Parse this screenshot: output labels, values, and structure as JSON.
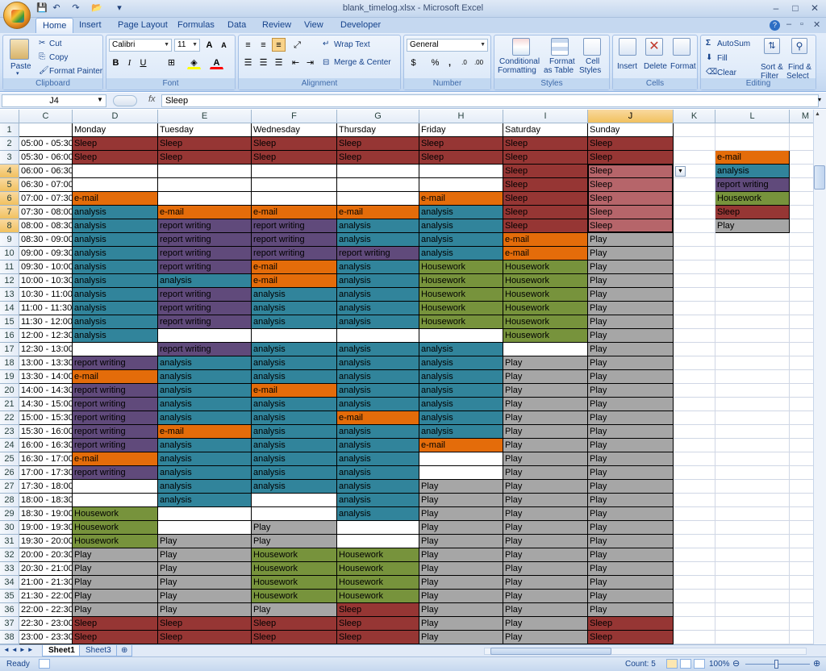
{
  "window": {
    "title": "blank_timelog.xlsx - Microsoft Excel"
  },
  "tabs": [
    "Home",
    "Insert",
    "Page Layout",
    "Formulas",
    "Data",
    "Review",
    "View",
    "Developer"
  ],
  "ribbon": {
    "clipboard": {
      "label": "Clipboard",
      "paste": "Paste",
      "cut": "Cut",
      "copy": "Copy",
      "format_painter": "Format Painter"
    },
    "font": {
      "label": "Font",
      "name": "Calibri",
      "size": "11",
      "bold": "B",
      "italic": "I",
      "underline": "U"
    },
    "alignment": {
      "label": "Alignment",
      "wrap": "Wrap Text",
      "merge": "Merge & Center"
    },
    "number": {
      "label": "Number",
      "format": "General",
      "currency": "$",
      "percent": "%",
      "comma": ","
    },
    "styles": {
      "label": "Styles",
      "conditional_l1": "Conditional",
      "conditional_l2": "Formatting",
      "table_l1": "Format",
      "table_l2": "as Table",
      "cell_l1": "Cell",
      "cell_l2": "Styles"
    },
    "cells": {
      "label": "Cells",
      "insert": "Insert",
      "delete": "Delete",
      "format": "Format"
    },
    "editing": {
      "label": "Editing",
      "autosum": "AutoSum",
      "fill": "Fill",
      "clear": "Clear",
      "sort_l1": "Sort &",
      "sort_l2": "Filter",
      "find_l1": "Find &",
      "find_l2": "Select"
    }
  },
  "formula_bar": {
    "name_box": "J4",
    "fx": "fx",
    "content": "Sleep"
  },
  "columns": [
    "C",
    "D",
    "E",
    "F",
    "G",
    "H",
    "I",
    "J",
    "K",
    "L",
    "M"
  ],
  "headers": [
    "Monday",
    "Tuesday",
    "Wednesday",
    "Thursday",
    "Friday",
    "Saturday",
    "Sunday"
  ],
  "times": [
    "05:00 - 05:30",
    "05:30 - 06:00",
    "06:00 - 06:30",
    "06:30 - 07:00",
    "07:00 - 07:30",
    "07:30 - 08:00",
    "08:00 - 08:30",
    "08:30 - 09:00",
    "09:00 - 09:30",
    "09:30 - 10:00",
    "10:00 - 10:30",
    "10:30 - 11:00",
    "11:00 - 11:30",
    "11:30 - 12:00",
    "12:00 - 12:30",
    "12:30 - 13:00",
    "13:00 - 13:30",
    "13:30 - 14:00",
    "14:00 - 14:30",
    "14:30 - 15:00",
    "15:00 - 15:30",
    "15:30 - 16:00",
    "16:00 - 16:30",
    "16:30 - 17:00",
    "17:00 - 17:30",
    "17:30 - 18:00",
    "18:00 - 18:30",
    "18:30 - 19:00",
    "19:00 - 19:30",
    "19:30 - 20:00",
    "20:00 - 20:30",
    "20:30 - 21:00",
    "21:00 - 21:30",
    "21:30 - 22:00",
    "22:00 - 22:30",
    "22:30 - 23:00",
    "23:00 - 23:30"
  ],
  "activity_codes": {
    "a": "analysis",
    "e": "e-mail",
    "r": "report writing",
    "h": "Housework",
    "s": "Sleep",
    "p": "Play",
    "w": ""
  },
  "colors": {
    "analysis": "#31849b",
    "e-mail": "#e46c0a",
    "report writing": "#604a7b",
    "Housework": "#77933c",
    "Sleep": "#963634",
    "Play": "#a6a6a6"
  },
  "grid": [
    "sssssss",
    "sssssss",
    "wwwwwss",
    "wwwwwss",
    "ewwwess",
    "aeeeass",
    "arraass",
    "arraaep",
    "arrraep",
    "areahhp",
    "aaeahhp",
    "araahhp",
    "araahhp",
    "araahhp",
    "awwwwhp",
    "wraaawp",
    "raaaapp",
    "eaaaapp",
    "raeaapp",
    "raaaapp",
    "raaeapp",
    "reaaapp",
    "raaaepp",
    "eaaawpp",
    "raaawpp",
    "waaappp",
    "wawappp",
    "hwwappp",
    "hwpwppp",
    "hppwppp",
    "pphhppp",
    "pphhppp",
    "pphhppp",
    "pphhppp",
    "pppsppp",
    "sssspps",
    "sssspps"
  ],
  "legend": [
    "e-mail",
    "analysis",
    "report writing",
    "Housework",
    "Sleep",
    "Play"
  ],
  "sheets": [
    "Sheet1",
    "Sheet3"
  ],
  "status": {
    "ready": "Ready",
    "count": "Count: 5",
    "zoom": "100%"
  }
}
